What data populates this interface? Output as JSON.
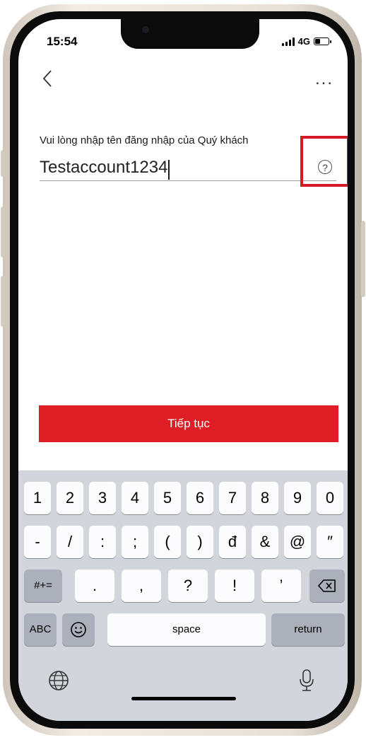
{
  "status_bar": {
    "time": "15:54",
    "network": "4G"
  },
  "nav": {
    "more_label": "..."
  },
  "form": {
    "label": "Vui lòng nhập tên đăng nhập của Quý khách",
    "username_value": "Testaccount1234",
    "help_symbol": "?"
  },
  "continue_button": {
    "label": "Tiếp tục"
  },
  "keyboard": {
    "row1": [
      "1",
      "2",
      "3",
      "4",
      "5",
      "6",
      "7",
      "8",
      "9",
      "0"
    ],
    "row2": [
      "-",
      "/",
      ":",
      ";",
      "(",
      ")",
      "đ",
      "&",
      "@",
      "″"
    ],
    "row3": {
      "toggle": "#+=",
      "keys": [
        ".",
        ",",
        "?",
        "!",
        "’"
      ]
    },
    "row4": {
      "abc": "ABC",
      "space": "space",
      "return": "return"
    }
  },
  "colors": {
    "accent": "#de1d25",
    "highlight": "#d41a25",
    "keyboard_bg": "#d2d5db"
  }
}
